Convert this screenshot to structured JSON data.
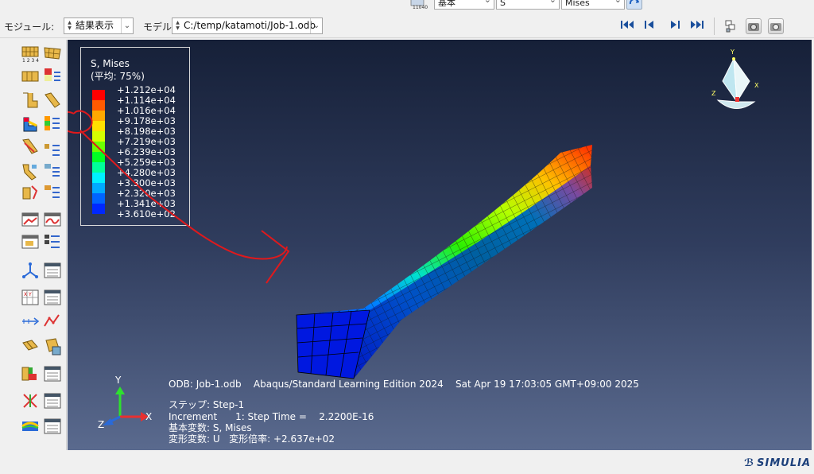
{
  "top_partial": {
    "combo_a": "基本",
    "combo_b": "S",
    "combo_c": "Mises"
  },
  "toolbar": {
    "module_label": "モジュール:",
    "module_value": "結果表示",
    "model_label": "モデル:",
    "model_value": "C:/temp/katamoti/Job-1.odb"
  },
  "legend": {
    "title": "S, Mises",
    "subtitle": "(平均: 75%)",
    "values": [
      "+1.212e+04",
      "+1.114e+04",
      "+1.016e+04",
      "+9.178e+03",
      "+8.198e+03",
      "+7.219e+03",
      "+6.239e+03",
      "+5.259e+03",
      "+4.280e+03",
      "+3.300e+03",
      "+2.320e+03",
      "+1.341e+03",
      "+3.610e+02"
    ],
    "colors": [
      "#ff0000",
      "#ff5a00",
      "#ffa800",
      "#ffe000",
      "#d4ff00",
      "#6cff00",
      "#00ff24",
      "#00ff9a",
      "#00f0ff",
      "#00aaff",
      "#0064ff",
      "#0028ff",
      "#0000ff"
    ]
  },
  "info": {
    "odb_line": "ODB: Job-1.odb    Abaqus/Standard Learning Edition 2024    Sat Apr 19 17:03:05 GMT+09:00 2025",
    "step_line": "ステップ: Step-1",
    "increment_line": "Increment      1: Step Time =    2.2200E-16",
    "primary_var_line": "基本変数: S, Mises",
    "deform_line": "変形変数: U   変形倍率: +2.637e+02"
  },
  "triad": {
    "y_label": "Y",
    "x_label": "X",
    "z_label": "Z"
  },
  "view_cube": {
    "y_label": "Y",
    "x_label": "X",
    "z_label": "Z"
  },
  "brand": "SIMULIA"
}
